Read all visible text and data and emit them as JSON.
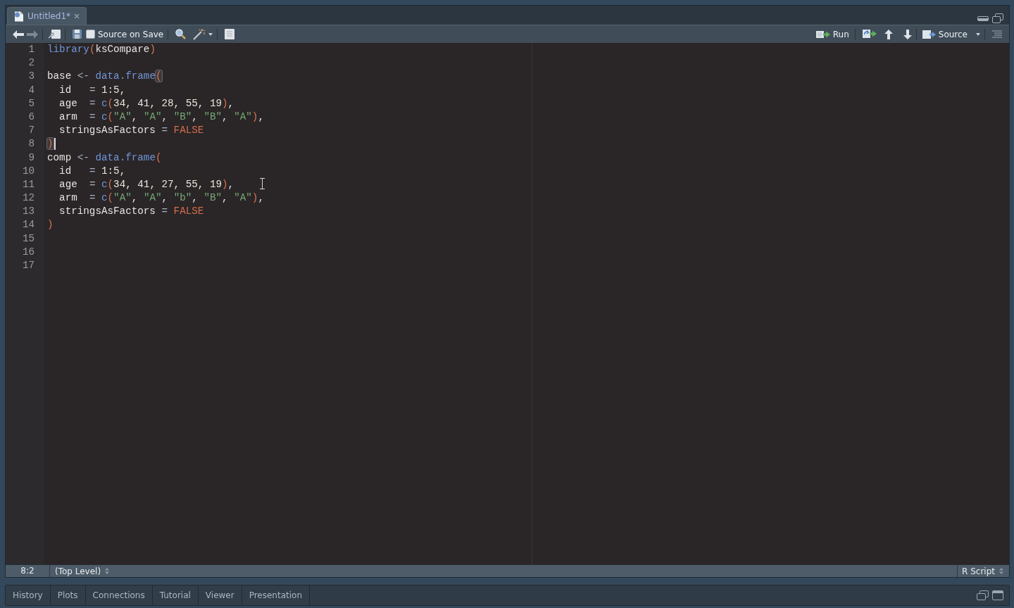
{
  "editor_tabs": [
    {
      "title": "Untitled1*",
      "selected": true
    }
  ],
  "toolbar": {
    "back": {
      "disabled": false
    },
    "forward": {
      "disabled": true
    },
    "source_on_save": {
      "label": "Source on Save",
      "checked": false
    },
    "run": {
      "label": "Run"
    },
    "source": {
      "label": "Source"
    }
  },
  "editor": {
    "lines": [
      {
        "number": "1",
        "caret": false,
        "tokens": [
          {
            "kind": "fn",
            "text": "library"
          },
          {
            "kind": "paren",
            "text": "("
          },
          {
            "kind": "plain",
            "text": "ksCompare"
          },
          {
            "kind": "paren",
            "text": ")"
          }
        ]
      },
      {
        "number": "2",
        "caret": false
      },
      {
        "number": "3",
        "caret": false,
        "tokens": [
          {
            "kind": "plain",
            "text": "base "
          },
          {
            "kind": "op",
            "text": "<- "
          },
          {
            "kind": "fn",
            "text": "data.frame"
          },
          {
            "kind": "paren_matched",
            "text": "("
          }
        ]
      },
      {
        "number": "4",
        "caret": false,
        "tokens": [
          {
            "kind": "plain",
            "text": "  id   "
          },
          {
            "kind": "op",
            "text": "= "
          },
          {
            "kind": "num",
            "text": "1:5"
          },
          {
            "kind": "plain",
            "text": ","
          }
        ]
      },
      {
        "number": "5",
        "caret": false,
        "tokens": [
          {
            "kind": "plain",
            "text": "  age  "
          },
          {
            "kind": "op",
            "text": "= "
          },
          {
            "kind": "fn",
            "text": "c"
          },
          {
            "kind": "paren",
            "text": "("
          },
          {
            "kind": "num",
            "text": "34, 41, 28, 55, 19"
          },
          {
            "kind": "paren",
            "text": ")"
          },
          {
            "kind": "plain",
            "text": ","
          }
        ]
      },
      {
        "number": "6",
        "caret": false,
        "tokens": [
          {
            "kind": "plain",
            "text": "  arm  "
          },
          {
            "kind": "op",
            "text": "= "
          },
          {
            "kind": "fn",
            "text": "c"
          },
          {
            "kind": "paren",
            "text": "("
          },
          {
            "kind": "str",
            "text": "\"A\""
          },
          {
            "kind": "plain",
            "text": ", "
          },
          {
            "kind": "str",
            "text": "\"A\""
          },
          {
            "kind": "plain",
            "text": ", "
          },
          {
            "kind": "str",
            "text": "\"B\""
          },
          {
            "kind": "plain",
            "text": ", "
          },
          {
            "kind": "str",
            "text": "\"B\""
          },
          {
            "kind": "plain",
            "text": ", "
          },
          {
            "kind": "str",
            "text": "\"A\""
          },
          {
            "kind": "paren",
            "text": ")"
          },
          {
            "kind": "plain",
            "text": ","
          }
        ]
      },
      {
        "number": "7",
        "caret": false,
        "tokens": [
          {
            "kind": "plain",
            "text": "  stringsAsFactors "
          },
          {
            "kind": "op",
            "text": "= "
          },
          {
            "kind": "const",
            "text": "FALSE"
          }
        ]
      },
      {
        "number": "8",
        "caret": true,
        "tokens": [
          {
            "kind": "paren_matched",
            "text": ")"
          }
        ]
      },
      {
        "number": "9",
        "caret": false,
        "tokens": [
          {
            "kind": "plain",
            "text": "comp "
          },
          {
            "kind": "op",
            "text": "<- "
          },
          {
            "kind": "fn",
            "text": "data.frame"
          },
          {
            "kind": "paren",
            "text": "("
          }
        ]
      },
      {
        "number": "10",
        "caret": false,
        "tokens": [
          {
            "kind": "plain",
            "text": "  id   "
          },
          {
            "kind": "op",
            "text": "= "
          },
          {
            "kind": "num",
            "text": "1:5"
          },
          {
            "kind": "plain",
            "text": ","
          }
        ]
      },
      {
        "number": "11",
        "caret": false,
        "tokens": [
          {
            "kind": "plain",
            "text": "  age  "
          },
          {
            "kind": "op",
            "text": "= "
          },
          {
            "kind": "fn",
            "text": "c"
          },
          {
            "kind": "paren",
            "text": "("
          },
          {
            "kind": "num",
            "text": "34, 41, 27, 55, 19"
          },
          {
            "kind": "paren",
            "text": ")"
          },
          {
            "kind": "plain",
            "text": ","
          }
        ]
      },
      {
        "number": "12",
        "caret": false,
        "tokens": [
          {
            "kind": "plain",
            "text": "  arm  "
          },
          {
            "kind": "op",
            "text": "= "
          },
          {
            "kind": "fn",
            "text": "c"
          },
          {
            "kind": "paren",
            "text": "("
          },
          {
            "kind": "str",
            "text": "\"A\""
          },
          {
            "kind": "plain",
            "text": ", "
          },
          {
            "kind": "str",
            "text": "\"A\""
          },
          {
            "kind": "plain",
            "text": ", "
          },
          {
            "kind": "str",
            "text": "\"b\""
          },
          {
            "kind": "plain",
            "text": ", "
          },
          {
            "kind": "str",
            "text": "\"B\""
          },
          {
            "kind": "plain",
            "text": ", "
          },
          {
            "kind": "str",
            "text": "\"A\""
          },
          {
            "kind": "paren",
            "text": ")"
          },
          {
            "kind": "plain",
            "text": ","
          }
        ]
      },
      {
        "number": "13",
        "caret": false,
        "tokens": [
          {
            "kind": "plain",
            "text": "  stringsAsFactors "
          },
          {
            "kind": "op",
            "text": "= "
          },
          {
            "kind": "const",
            "text": "FALSE"
          }
        ]
      },
      {
        "number": "14",
        "caret": false,
        "tokens": [
          {
            "kind": "paren",
            "text": ")"
          }
        ]
      },
      {
        "number": "15",
        "caret": false
      },
      {
        "number": "16",
        "caret": false
      },
      {
        "number": "17",
        "caret": false
      }
    ]
  },
  "status_bar": {
    "position": "8:2",
    "scope": "(Top Level)",
    "file_type": "R Script"
  },
  "bottom_tabs": [
    {
      "label": "History",
      "selected": false
    },
    {
      "label": "Plots",
      "selected": false
    },
    {
      "label": "Connections",
      "selected": false
    },
    {
      "label": "Tutorial",
      "selected": false
    },
    {
      "label": "Viewer",
      "selected": false
    },
    {
      "label": "Presentation",
      "selected": false
    }
  ]
}
